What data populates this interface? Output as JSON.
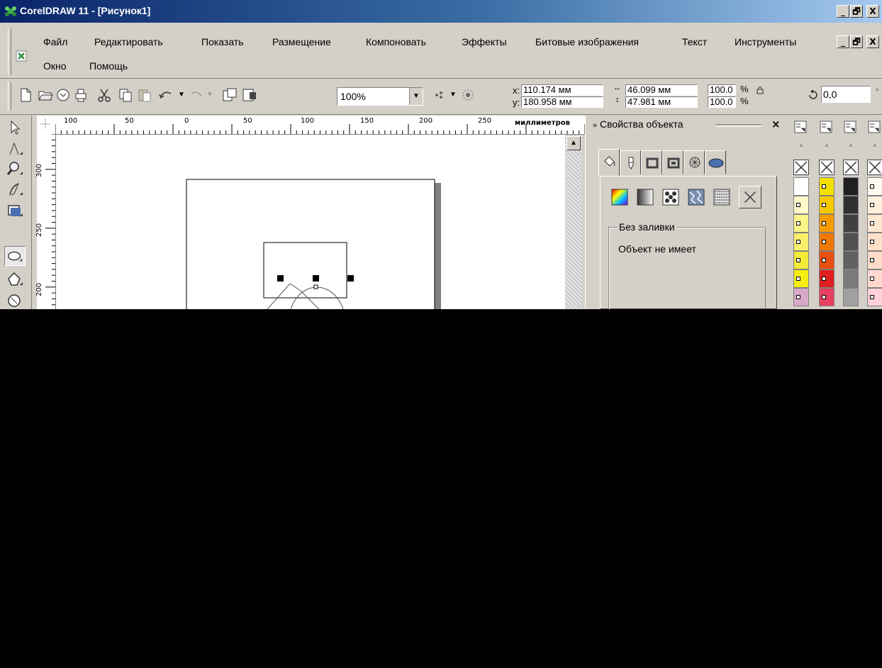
{
  "window": {
    "title": "CorelDRAW 11 - [Рисунок1]",
    "buttons": {
      "minimize": "_",
      "restore": "🗗",
      "close": "X"
    }
  },
  "menu": [
    {
      "label": "Файл"
    },
    {
      "label": "Редактировать"
    },
    {
      "label": "Показать"
    },
    {
      "label": "Размещение"
    },
    {
      "label": "Компоновать"
    },
    {
      "label": "Эффекты"
    },
    {
      "label": "Битовые изображения"
    },
    {
      "label": "Текст"
    },
    {
      "label": "Инструменты"
    },
    {
      "label": "Окно"
    },
    {
      "label": "Помощь"
    }
  ],
  "toolbar": {
    "zoom": "100%",
    "x_label": "x:",
    "x_value": "110.174 мм",
    "y_label": "y:",
    "y_value": "180.958 мм",
    "width_value": "46.099 мм",
    "height_value": "47.981 мм",
    "scale_x": "100.0",
    "scale_y": "100.0",
    "percent": "%",
    "rotation": "0,0"
  },
  "ruler": {
    "horizontal_labels": [
      "100",
      "50",
      "0",
      "50",
      "100",
      "150",
      "200",
      "250"
    ],
    "vertical_labels": [
      "300",
      "250",
      "200"
    ],
    "units": "миллиметров"
  },
  "docker": {
    "title": "Свойства объекта",
    "group_label": "Без заливки",
    "group_text": "Объект не имеет"
  },
  "palette_colors": [
    [
      "#ffffff",
      "#fff7c8",
      "#fbf58a",
      "#f8f06a",
      "#f4ea3a",
      "#f5ec10",
      "#d8a8c8"
    ],
    [
      "#f4e000",
      "#f7c800",
      "#f59a00",
      "#f07800",
      "#e85010",
      "#e02020",
      "#e84060"
    ],
    [
      "#202020",
      "#303030",
      "#404040",
      "#505050",
      "#606060",
      "#7a7a7a",
      "#a0a0a0"
    ],
    [
      "#fffaf0",
      "#fff0dc",
      "#ffe8d0",
      "#ffe0c8",
      "#ffdcc8",
      "#ffd8d0",
      "#ffd0d8"
    ]
  ]
}
